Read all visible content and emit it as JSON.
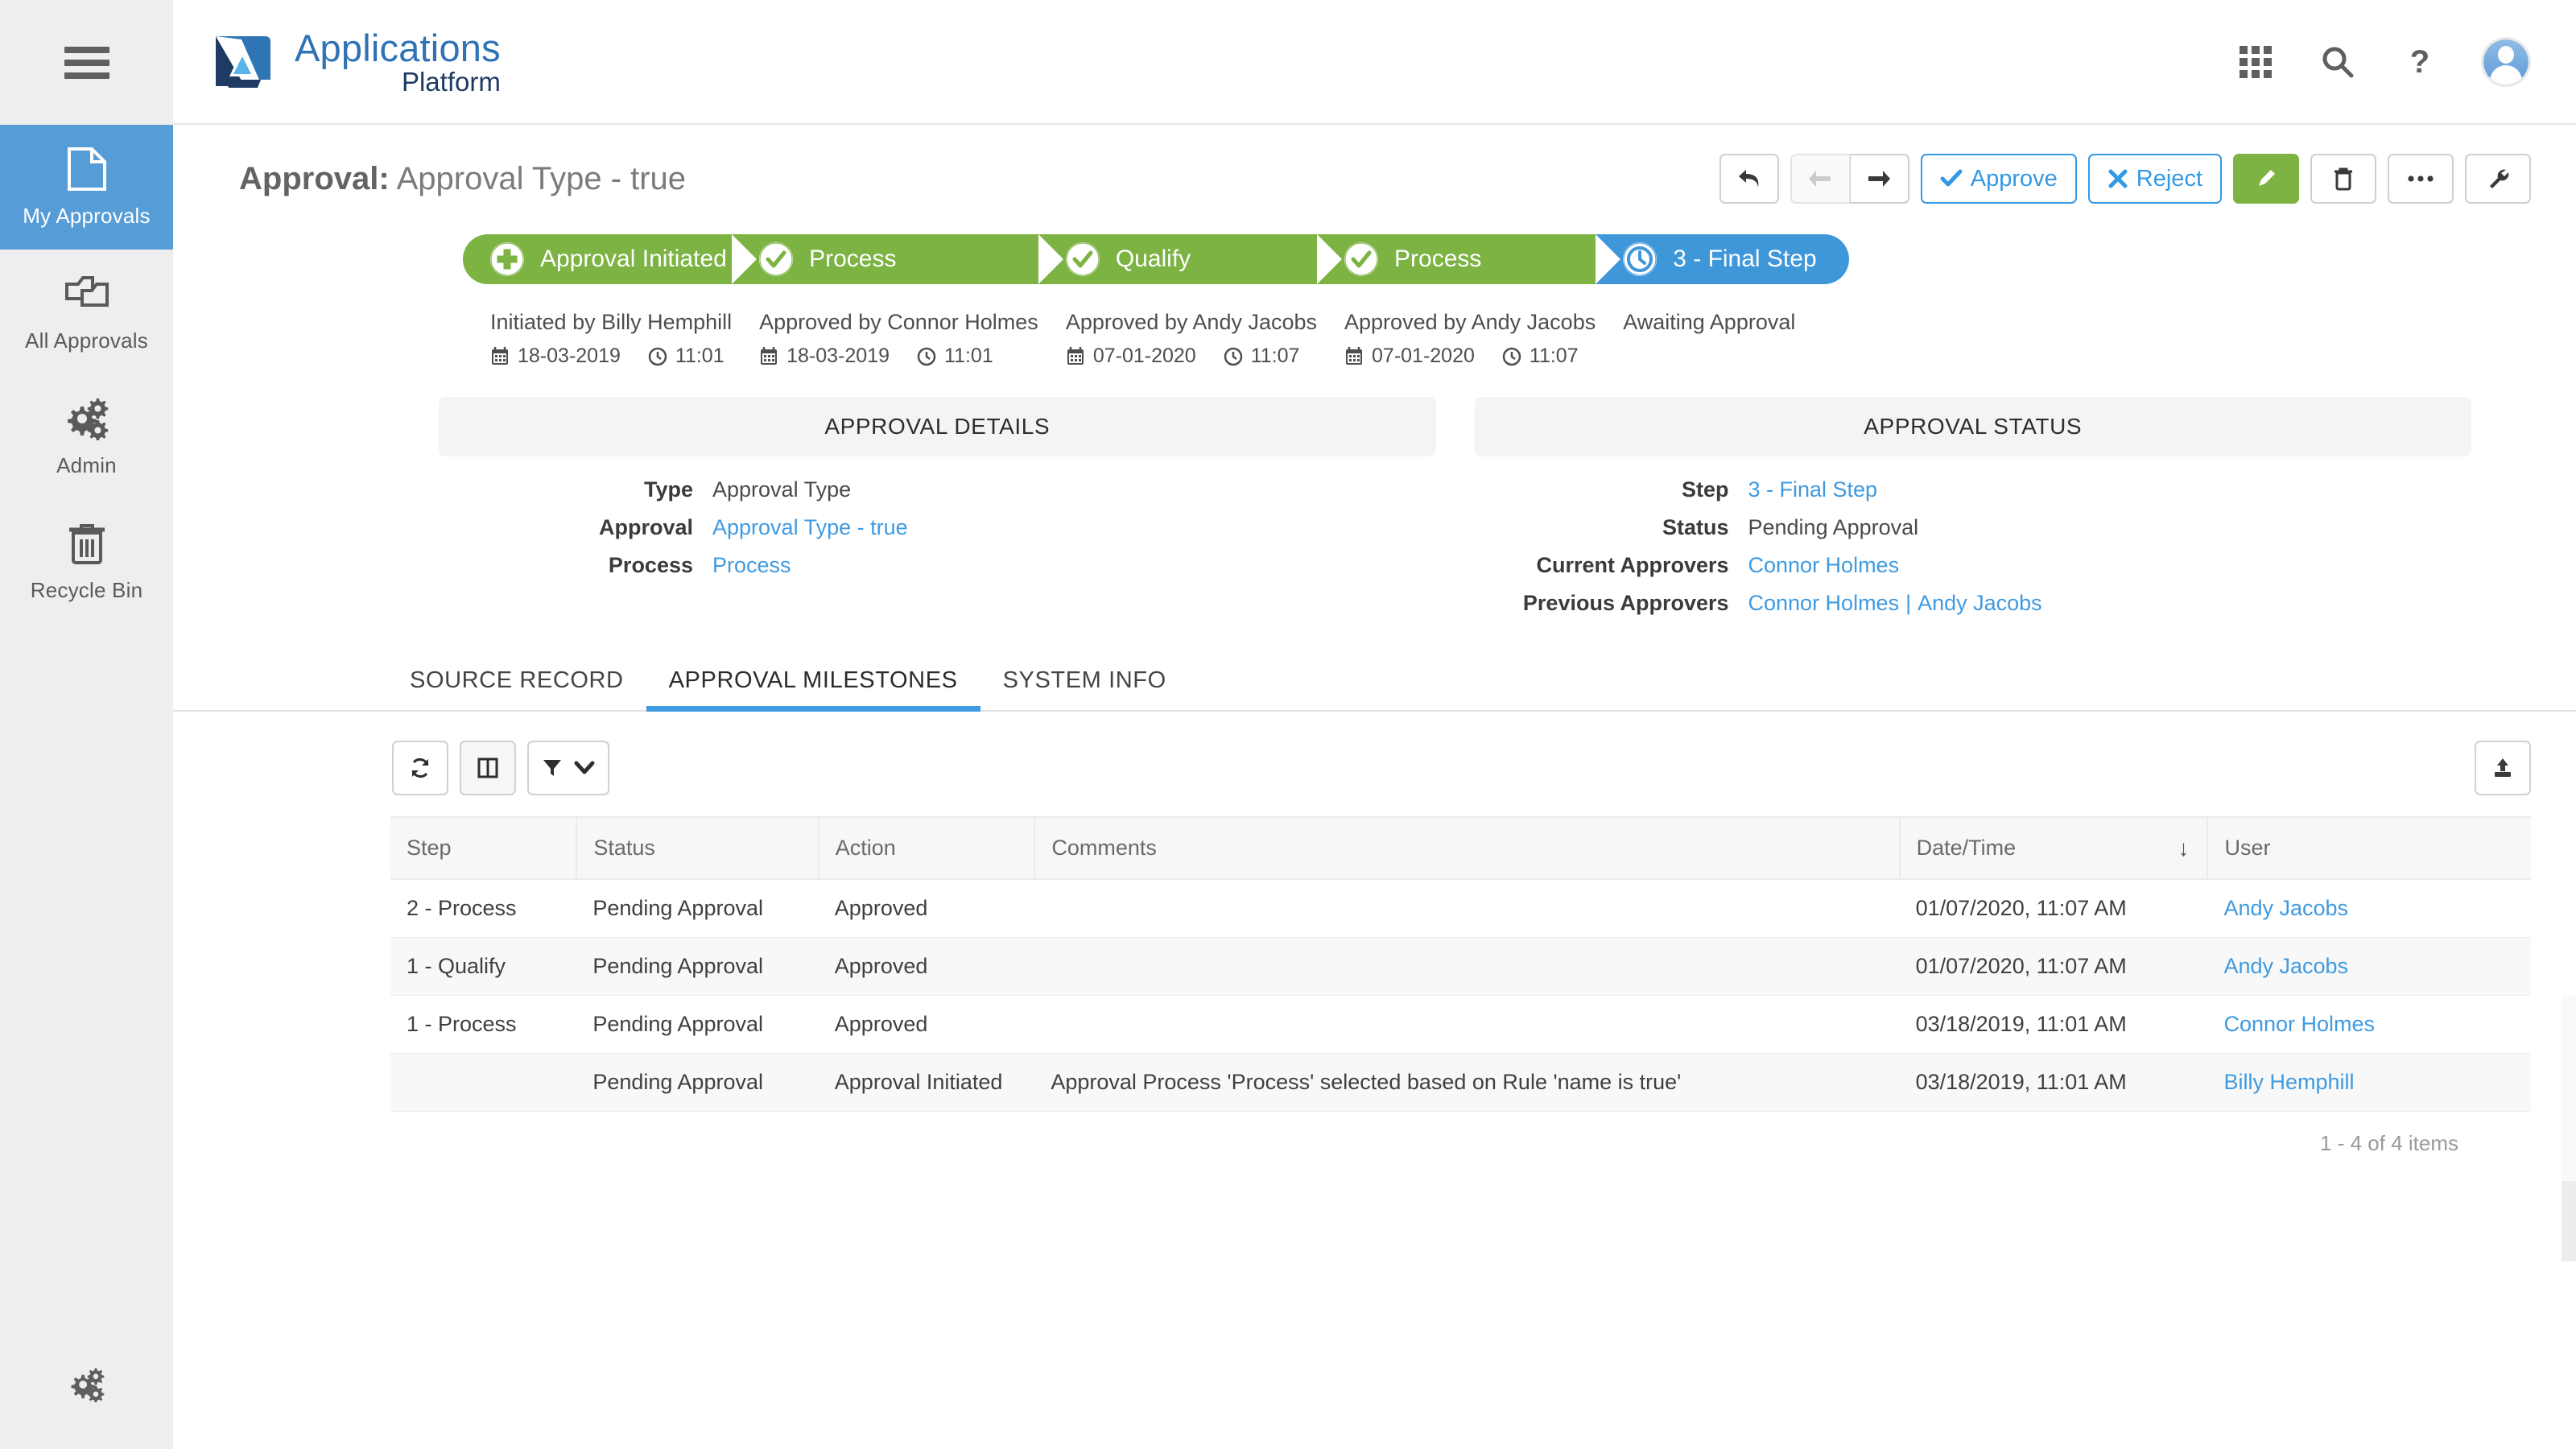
{
  "app": {
    "logo_line1": "Applications",
    "logo_line2": "Platform",
    "menu_icon": "hamburger-icon"
  },
  "sidebar": {
    "items": [
      {
        "label": "My Approvals",
        "icon": "document-icon",
        "active": true
      },
      {
        "label": "All Approvals",
        "icon": "copies-icon",
        "active": false
      },
      {
        "label": "Admin",
        "icon": "gears-icon",
        "active": false
      },
      {
        "label": "Recycle Bin",
        "icon": "trash-icon",
        "active": false
      }
    ],
    "settings_icon": "gears-icon"
  },
  "header": {
    "title_prefix": "Approval:",
    "title_value": "Approval Type - true",
    "icons": {
      "apps": "grid-apps-icon",
      "search": "search-icon",
      "help": "question-mark-icon",
      "avatar": "user-avatar"
    }
  },
  "toolbar": {
    "back_label": "",
    "prev_label": "",
    "next_label": "",
    "approve_label": "Approve",
    "reject_label": "Reject",
    "edit_label": "",
    "delete_label": "",
    "more_label": "",
    "tools_label": ""
  },
  "workflow": {
    "steps": [
      {
        "label": "Approval Initiated",
        "state": "green",
        "icon": "plus-circle-icon",
        "meta_who": "Initiated by Billy Hemphill",
        "meta_date": "18-03-2019",
        "meta_time": "11:01"
      },
      {
        "label": "Process",
        "state": "green",
        "icon": "check-circle-icon",
        "meta_who": "Approved by Connor Holmes",
        "meta_date": "18-03-2019",
        "meta_time": "11:01"
      },
      {
        "label": "Qualify",
        "state": "green",
        "icon": "check-circle-icon",
        "meta_who": "Approved by Andy Jacobs",
        "meta_date": "07-01-2020",
        "meta_time": "11:07"
      },
      {
        "label": "Process",
        "state": "green",
        "icon": "check-circle-icon",
        "meta_who": "Approved by Andy Jacobs",
        "meta_date": "07-01-2020",
        "meta_time": "11:07"
      },
      {
        "label": "3 - Final Step",
        "state": "blue",
        "icon": "clock-icon",
        "meta_who": "Awaiting Approval",
        "meta_date": "",
        "meta_time": ""
      }
    ]
  },
  "details_panel": {
    "heading": "APPROVAL DETAILS",
    "rows": [
      {
        "label": "Type",
        "value": "Approval Type",
        "link": false
      },
      {
        "label": "Approval",
        "value": "Approval Type - true",
        "link": true
      },
      {
        "label": "Process",
        "value": "Process",
        "link": true
      }
    ]
  },
  "status_panel": {
    "heading": "APPROVAL STATUS",
    "rows": [
      {
        "label": "Step",
        "value": "3 - Final Step",
        "link": true
      },
      {
        "label": "Status",
        "value": "Pending Approval",
        "link": false
      },
      {
        "label": "Current Approvers",
        "value": "Connor Holmes",
        "link": true
      },
      {
        "label": "Previous Approvers",
        "value": "Connor Holmes",
        "value2": "Andy Jacobs",
        "separator": "|",
        "link": true
      }
    ]
  },
  "tabs": [
    {
      "label": "SOURCE RECORD",
      "active": false
    },
    {
      "label": "APPROVAL MILESTONES",
      "active": true
    },
    {
      "label": "SYSTEM INFO",
      "active": false
    }
  ],
  "gridbar": {
    "refresh_icon": "refresh-icon",
    "columns_icon": "columns-icon",
    "filter_icon": "filter-icon",
    "filter_chevron_icon": "chevron-down-icon",
    "export_icon": "export-upload-icon"
  },
  "table": {
    "columns": [
      "Step",
      "Status",
      "Action",
      "Comments",
      "Date/Time",
      "User"
    ],
    "sorted_column": "Date/Time",
    "sort_direction_icon": "arrow-down-icon",
    "rows": [
      {
        "step": "2 - Process",
        "status": "Pending Approval",
        "action": "Approved",
        "comments": "",
        "datetime": "01/07/2020, 11:07 AM",
        "user": "Andy Jacobs"
      },
      {
        "step": "1 - Qualify",
        "status": "Pending Approval",
        "action": "Approved",
        "comments": "",
        "datetime": "01/07/2020, 11:07 AM",
        "user": "Andy Jacobs"
      },
      {
        "step": "1 - Process",
        "status": "Pending Approval",
        "action": "Approved",
        "comments": "",
        "datetime": "03/18/2019, 11:01 AM",
        "user": "Connor Holmes"
      },
      {
        "step": "",
        "status": "Pending Approval",
        "action": "Approval Initiated",
        "comments": "Approval Process 'Process' selected based on Rule 'name is true'",
        "datetime": "03/18/2019, 11:01 AM",
        "user": "Billy Hemphill"
      }
    ],
    "pager": "1 - 4 of 4 items"
  },
  "colors": {
    "accent_blue": "#3f9ae0",
    "sidebar_active": "#569cd6",
    "approved_green": "#7cb342",
    "pending_blue": "#3e97d9"
  }
}
